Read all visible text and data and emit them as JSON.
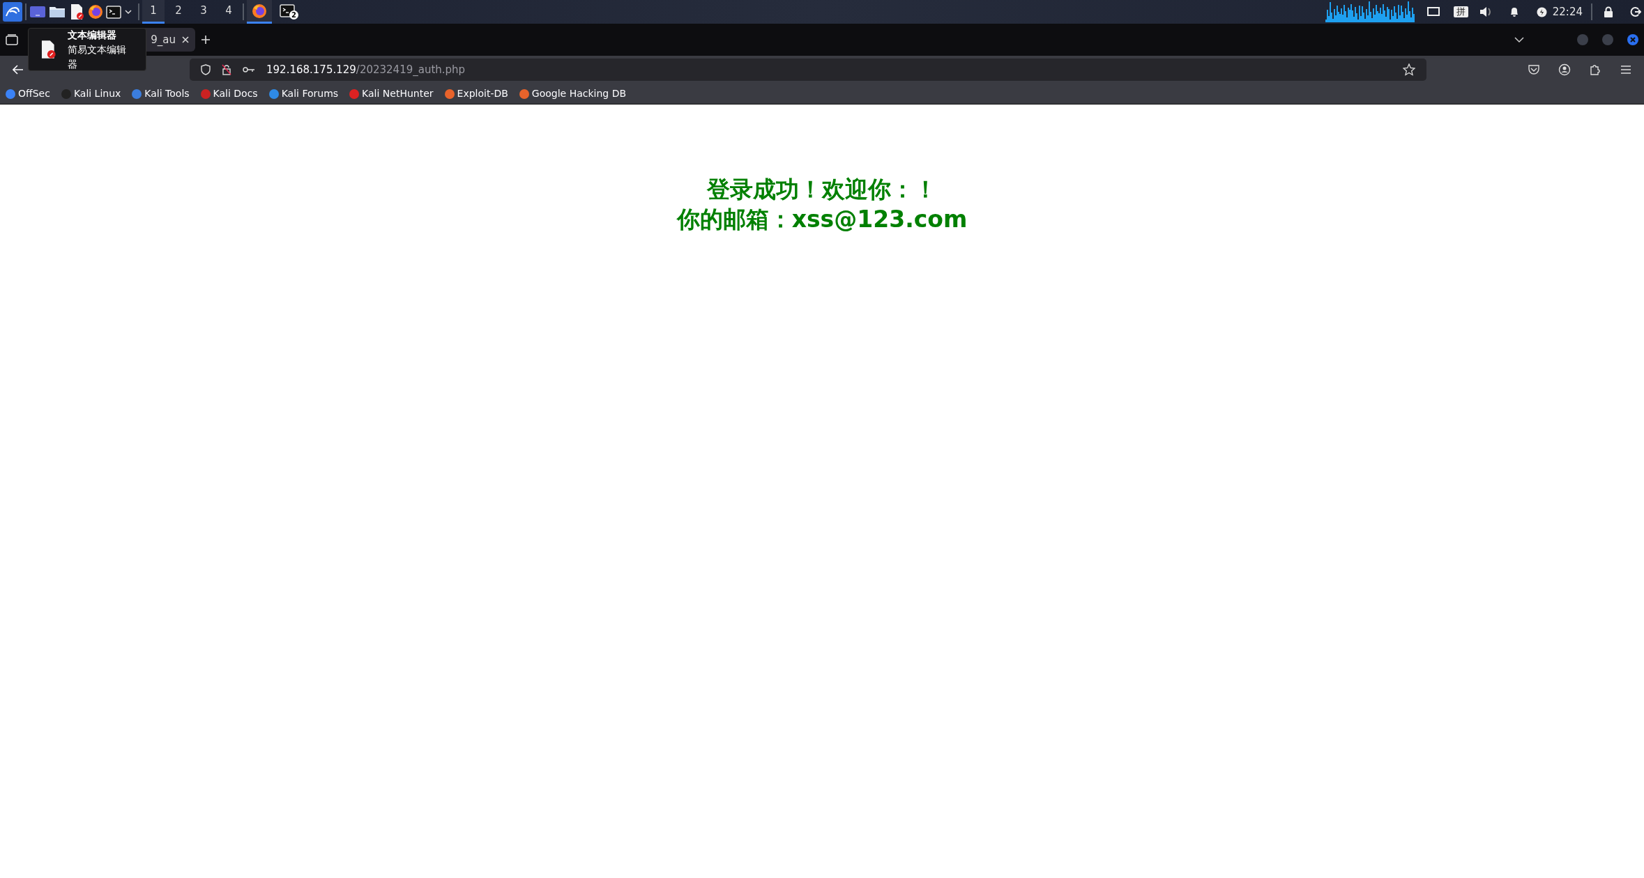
{
  "taskbar": {
    "workspaces": [
      {
        "label": "1",
        "selected": true
      },
      {
        "label": "2",
        "selected": false
      },
      {
        "label": "3",
        "selected": false
      },
      {
        "label": "4",
        "selected": false
      }
    ],
    "tasks": [
      {
        "kind": "firefox",
        "selected": true
      },
      {
        "kind": "terminal",
        "selected": false,
        "badge": "2"
      }
    ],
    "input_method": "拼",
    "clock": "22:24"
  },
  "browser": {
    "tabs": [
      {
        "title": "9_au",
        "selected": true
      }
    ],
    "tooltip": {
      "title": "文本编辑器",
      "subtitle": "简易文本编辑器"
    },
    "address": {
      "host": "192.168.175.129",
      "path": "/20232419_auth.php"
    },
    "bookmarks": [
      {
        "label": "OffSec",
        "color": "#3b82f6"
      },
      {
        "label": "Kali Linux",
        "color": "#222222"
      },
      {
        "label": "Kali Tools",
        "color": "#3b7ddd"
      },
      {
        "label": "Kali Docs",
        "color": "#cc2222"
      },
      {
        "label": "Kali Forums",
        "color": "#2e8ae6"
      },
      {
        "label": "Kali NetHunter",
        "color": "#dd2222"
      },
      {
        "label": "Exploit-DB",
        "color": "#e8632b"
      },
      {
        "label": "Google Hacking DB",
        "color": "#e8632b"
      }
    ]
  },
  "page": {
    "lines": [
      "登录成功！欢迎你：！",
      "你的邮箱：xss@123.com"
    ]
  }
}
